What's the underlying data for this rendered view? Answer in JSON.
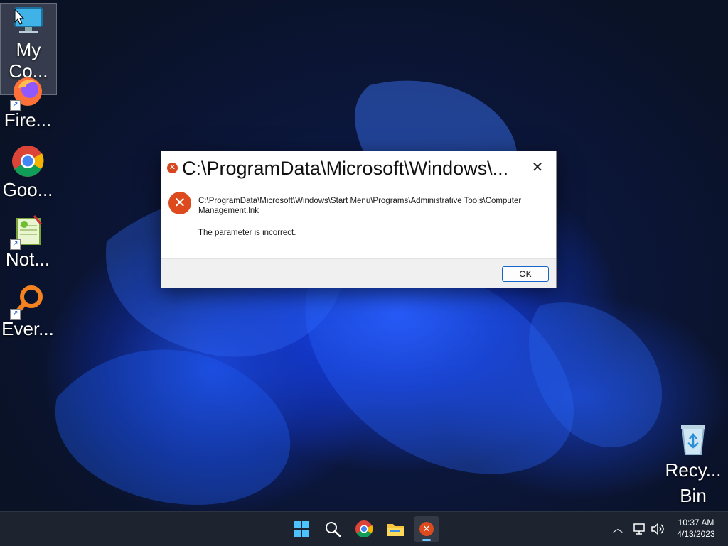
{
  "desktop": {
    "icons": [
      {
        "label": "My\nCo...",
        "icon": "computer-icon"
      },
      {
        "label": "Fire...",
        "icon": "firefox-icon"
      },
      {
        "label": "Goo...\nChr...",
        "icon": "chrome-icon"
      },
      {
        "label": "Not...",
        "icon": "notepad-plus-plus-icon"
      },
      {
        "label": "Ever...",
        "icon": "everything-search-icon"
      },
      {
        "label": "Recy...\nBin",
        "icon": "recycle-bin-icon"
      }
    ]
  },
  "dialog": {
    "title": "C:\\ProgramData\\Microsoft\\Windows\\...",
    "path": "C:\\ProgramData\\Microsoft\\Windows\\Start Menu\\Programs\\Administrative Tools\\Computer Management.lnk",
    "message": "The parameter is incorrect.",
    "ok_label": "OK",
    "close_glyph": "✕"
  },
  "taskbar": {
    "apps": [
      "start-icon",
      "search-icon",
      "chrome-icon",
      "file-explorer-icon",
      "error-dialog-icon"
    ],
    "clock_time": "10:37 AM",
    "clock_date": "4/13/2023"
  },
  "colors": {
    "accent": "#1566c8",
    "error": "#dc4a1e",
    "taskbar": "#1d2430"
  }
}
